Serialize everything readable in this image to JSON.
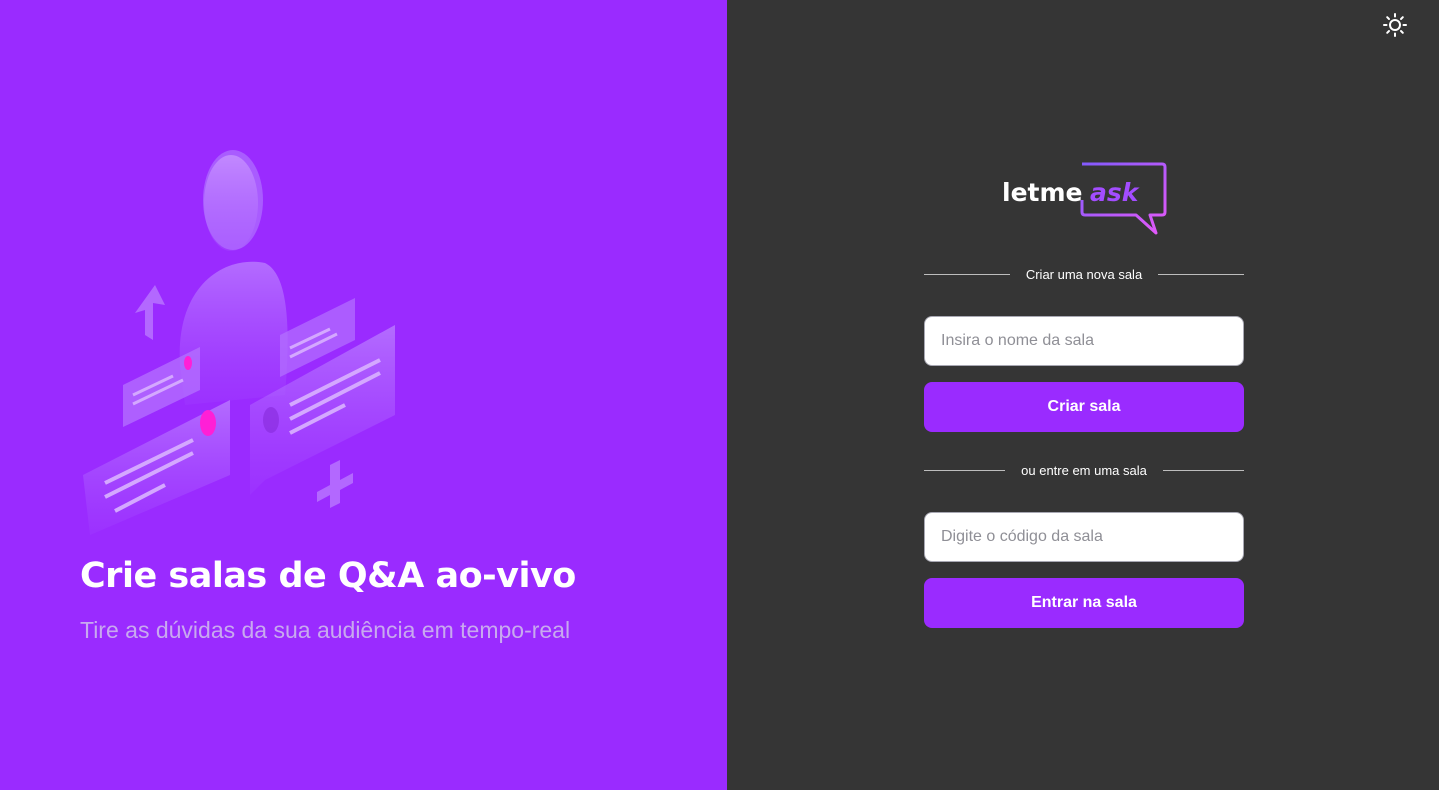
{
  "aside": {
    "title": "Crie salas de Q&A ao-vivo",
    "subtitle": "Tire as dúvidas da sua audiência em tempo-real"
  },
  "logo": {
    "word1": "letme",
    "word2": "ask"
  },
  "create": {
    "divider_label": "Criar uma nova sala",
    "placeholder": "Insira o nome da sala",
    "button_label": "Criar sala"
  },
  "join": {
    "divider_label": "ou entre em uma sala",
    "placeholder": "Digite o código da sala",
    "button_label": "Entrar na sala"
  },
  "icons": {
    "theme_toggle": "sun-icon",
    "illustration": "qa-illustration"
  },
  "colors": {
    "brand": "#9a2bff",
    "accent": "#e559f9",
    "panel_dark": "#353535",
    "subtitle": "#c8a9ef"
  }
}
